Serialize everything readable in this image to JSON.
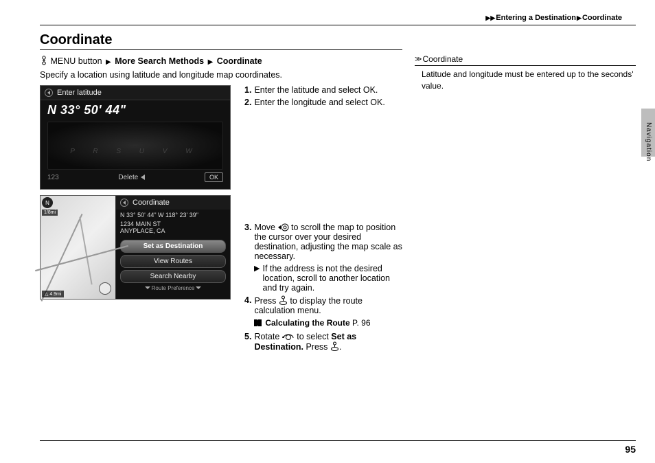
{
  "breadcrumb": {
    "l1": "Entering a Destination",
    "l2": "Coordinate"
  },
  "title": "Coordinate",
  "path": {
    "menu": "MENU button",
    "p1": "More Search Methods",
    "p2": "Coordinate"
  },
  "desc": "Specify a location using latitude and longitude map coordinates.",
  "screen1": {
    "header": "Enter latitude",
    "value": "N 33° 50' 44\"",
    "dial_letters": "P R S U V W",
    "num": "123",
    "delete": "Delete",
    "ok": "OK"
  },
  "screen2": {
    "header": "Coordinate",
    "north": "N",
    "scale": "1/8mi",
    "dist": "4.9mi",
    "coords": "N 33° 50' 44\" W 118° 23' 39\"",
    "addr1": "1234 MAIN ST",
    "addr2": "ANYPLACE, CA",
    "m1": "Set as Destination",
    "m2": "View Routes",
    "m3": "Search Nearby",
    "pref": "Route Preference"
  },
  "steps": {
    "s1": "Enter the latitude and select OK.",
    "s2": "Enter the longitude and select OK.",
    "s3": "to scroll the map to position the cursor over your desired destination, adjusting the map scale as necessary.",
    "s3_pre": "Move",
    "s3_sub": "If the address is not the desired location, scroll to another location and try again.",
    "s4_pre": "Press",
    "s4": "to display the route calculation menu.",
    "s4_ref": "Calculating the Route",
    "s4_page": "P. 96",
    "s5_pre": "Rotate",
    "s5_mid": "to select",
    "s5_bold": "Set as Destination.",
    "s5_post": "Press"
  },
  "sidebar": {
    "head": "Coordinate",
    "note": "Latitude and longitude must be entered up to the seconds' value.",
    "tab": "Navigation"
  },
  "page_number": "95"
}
